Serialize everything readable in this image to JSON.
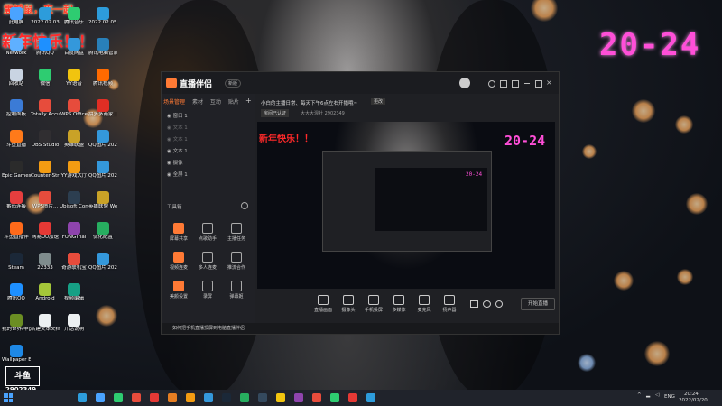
{
  "greeting": {
    "line1": "震撼鼠，来一起",
    "line2": "新年快乐！！"
  },
  "overlay_clock": "20-24",
  "desktop_icons": [
    {
      "label": "此电脑",
      "color": "#4aa3ff"
    },
    {
      "label": "Network",
      "color": "#5fb0ff"
    },
    {
      "label": "回收站",
      "color": "#c9d4e2"
    },
    {
      "label": "控制面板",
      "color": "#3b7bd6"
    },
    {
      "label": "斗鱼直播",
      "color": "#ff7a1a"
    },
    {
      "label": "Epic Games Launcher",
      "color": "#2b2b2b"
    },
    {
      "label": "番茄连接",
      "color": "#e53e3e"
    },
    {
      "label": "斗鱼直播伴",
      "color": "#ff6a1a"
    },
    {
      "label": "Steam",
      "color": "#1b2838"
    },
    {
      "label": "腾讯QQ",
      "color": "#1e90ff"
    },
    {
      "label": "我的世界(中国版)",
      "color": "#6b8e23"
    },
    {
      "label": "Wallpaper Engine",
      "color": "#1e88e5"
    }
  ],
  "desktop_icons_col2": [
    {
      "label": "2022.02.03",
      "color": "#2d9cdb"
    },
    {
      "label": "腾讯QQ",
      "color": "#1e90ff"
    },
    {
      "label": "微信",
      "color": "#2ecc71"
    },
    {
      "label": "Totally Accurate...",
      "color": "#e74c3c"
    },
    {
      "label": "OBS Studio",
      "color": "#302e31"
    },
    {
      "label": "Counter-Strike Global Off...",
      "color": "#f39c12"
    },
    {
      "label": "WPS图片...",
      "color": "#e74c3c"
    },
    {
      "label": "网易UU加速",
      "color": "#e53935"
    },
    {
      "label": "22333",
      "color": "#7f8c8d"
    },
    {
      "label": "Android",
      "color": "#a4c639"
    },
    {
      "label": "新建文本文档",
      "color": "#ecf0f1"
    }
  ],
  "desktop_icons_col3": [
    {
      "label": "腾讯音乐",
      "color": "#2ecc71"
    },
    {
      "label": "百度网盘",
      "color": "#3498db"
    },
    {
      "label": "YY语音",
      "color": "#f1c40f"
    },
    {
      "label": "WPS Office",
      "color": "#e74c3c"
    },
    {
      "label": "英雄联盟",
      "color": "#c9a227"
    },
    {
      "label": "YY游戏大厅",
      "color": "#f39c12"
    },
    {
      "label": "Ubisoft Connect",
      "color": "#2c3e50"
    },
    {
      "label": "FUNGTrial",
      "color": "#8e44ad"
    },
    {
      "label": "奇游联机宝",
      "color": "#e74c3c"
    },
    {
      "label": "视频编辑",
      "color": "#16a085"
    },
    {
      "label": "开话说明",
      "color": "#ecf0f1"
    }
  ],
  "desktop_icons_col4": [
    {
      "label": "2022.02.05...",
      "color": "#2d9cdb"
    },
    {
      "label": "腾讯电脑管家",
      "color": "#2980b9"
    },
    {
      "label": "腾讯视频",
      "color": "#ff6a00"
    },
    {
      "label": "拼多多商家工作台",
      "color": "#e02e24"
    },
    {
      "label": "QQ图片 20211230...",
      "color": "#3498db"
    },
    {
      "label": "QQ图片 20211230...",
      "color": "#3498db"
    },
    {
      "label": "英雄联盟 WeGame",
      "color": "#c9a227"
    },
    {
      "label": "优化配置",
      "color": "#27ae60"
    },
    {
      "label": "QQ图片 20220215...",
      "color": "#3498db"
    }
  ],
  "app": {
    "title": "直播伴侣",
    "badge": "新版",
    "notice": "小白的主播日常、每天下午6点左右开播哦~",
    "notice_btn": "更改",
    "room_btn": "房间已认证",
    "room_info": "大大大混社  2902349",
    "tabs": [
      "场景管理",
      "素材",
      "互动",
      "贴片"
    ],
    "scenes": [
      "窗口 1",
      "文本 1",
      "文本 1",
      "文本 1",
      "摄像",
      "全屏 1"
    ],
    "tools_title": "工具箱",
    "tools": [
      "屏幕共享",
      "点歌助手",
      "主播任务",
      "视频连麦",
      "多人连麦",
      "推流合作",
      "美颜设置",
      "录屏",
      "弹幕姬"
    ],
    "bottom_buttons": [
      "直播画面",
      "摄像头",
      "手机投屏",
      "多媒体",
      "麦克风",
      "扬声器"
    ],
    "start_live": "开始直播",
    "status": "如何把手机直播投屏到电脑直播伴侣"
  },
  "taskbar": {
    "lang": "ENG",
    "time": "20:24",
    "date": "2022/02/20",
    "icon_colors": [
      "#2d9cdb",
      "#4aa3ff",
      "#2ecc71",
      "#e74c3c",
      "#e53935",
      "#e67e22",
      "#f39c12",
      "#3498db",
      "#1b2838",
      "#27ae60",
      "#34495e",
      "#f1c40f",
      "#8e44ad",
      "#e74c3c",
      "#2ecc71",
      "#e53935",
      "#2d9cdb"
    ]
  },
  "watermark": {
    "logo": "斗鱼",
    "room_id": "2902349"
  }
}
